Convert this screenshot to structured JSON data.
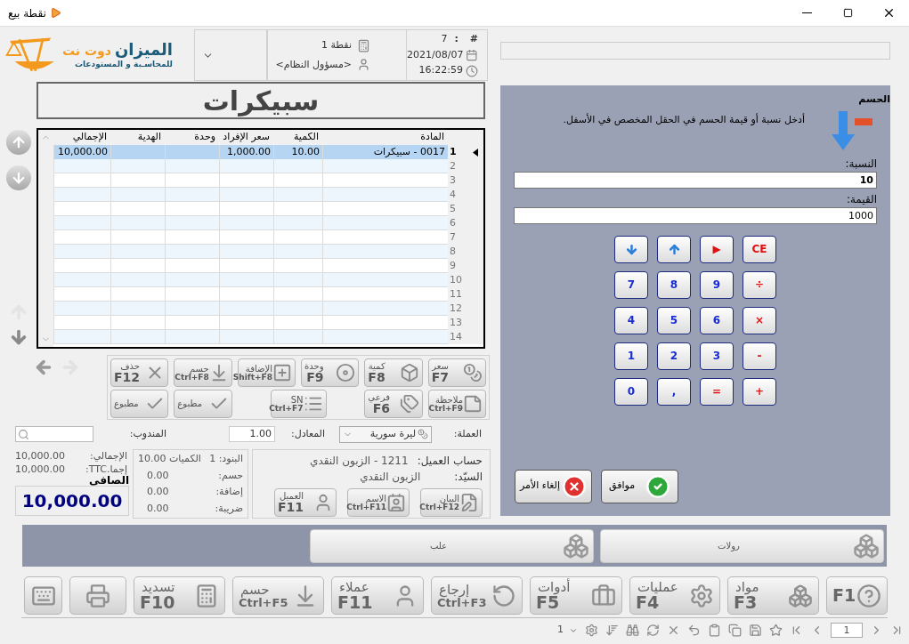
{
  "window": {
    "title": "نقطة بيع"
  },
  "logo": {
    "name": "الميزان",
    "suffix": "دوت نت",
    "tagline": "للمحاسـبة و المستودعات"
  },
  "info": {
    "number_label": "#",
    "number_sep": ":",
    "number": "7",
    "date": "2021/08/07",
    "time": "16:22:59",
    "point": "نقطة 1",
    "user": "<مسؤول النظام>"
  },
  "item_title": "سبيكرات",
  "table": {
    "columns": [
      "المادة",
      "الكمية",
      "سعر الإفراد",
      "وحدة",
      "الهدية",
      "الإجمالي"
    ],
    "rows": [
      {
        "number": "1",
        "selected": true,
        "item": "0017 - سبيكرات",
        "quantity": "10.00",
        "unit_price": "1,000.00",
        "total": "10,000.00"
      },
      {
        "number": "2",
        "selected": false
      },
      {
        "number": "3",
        "selected": false
      },
      {
        "number": "4",
        "selected": false
      },
      {
        "number": "5",
        "selected": false
      },
      {
        "number": "6",
        "selected": false
      },
      {
        "number": "7",
        "selected": false
      },
      {
        "number": "8",
        "selected": false
      },
      {
        "number": "9",
        "selected": false
      },
      {
        "number": "10",
        "selected": false
      },
      {
        "number": "11",
        "selected": false
      },
      {
        "number": "12",
        "selected": false
      },
      {
        "number": "13",
        "selected": false
      },
      {
        "number": "14",
        "selected": false
      }
    ]
  },
  "actions": [
    [
      {
        "label": "سعر",
        "key": "F7"
      },
      {
        "label": "كمية",
        "key": "F8"
      },
      {
        "label": "وحدة",
        "key": "F9"
      },
      {
        "label": "الإضافة",
        "key": "Shift+F8"
      },
      {
        "label": "حسم",
        "key": "Ctrl+F8"
      },
      {
        "label": "حذف",
        "key": "F12"
      }
    ],
    [
      {
        "label": "ملاحظة",
        "key": "Ctrl+F9"
      },
      {
        "label": "فرعي",
        "key": "F6"
      },
      {
        "label": "SN",
        "key": "Ctrl+F7"
      },
      {
        "label": "مطبوع"
      },
      {
        "label": "مطبوع"
      }
    ]
  ],
  "currency": {
    "label": "العملة:",
    "value": "ليرة سورية"
  },
  "rate": {
    "label": "المعادل:",
    "value": "1.00"
  },
  "rep": {
    "label": "المندوب:"
  },
  "customer": {
    "account_label": "حساب العميل:",
    "account": "1211 - الزبون النقدي",
    "name_label": "السيّد:",
    "name": "الزبون النقدي",
    "buttons": [
      {
        "label": "البيان",
        "key": "Ctrl+F12"
      },
      {
        "label": "الاسم",
        "key": "Ctrl+F11"
      },
      {
        "label": "العميل",
        "key": "F11"
      }
    ]
  },
  "summary": {
    "items_label": "البنود:",
    "items": "1",
    "quantities_label": "الكميات",
    "quantities": "10.00",
    "lines": [
      {
        "label": "حسم:",
        "value": "0.00"
      },
      {
        "label": "إضافة:",
        "value": "0.00"
      },
      {
        "label": "ضريبة:",
        "value": "0.00"
      }
    ]
  },
  "totals": {
    "lines": [
      {
        "label": "الإجمالي:",
        "value": "10,000.00"
      },
      {
        "label": "إجما.TTC:",
        "value": "10,000.00"
      }
    ],
    "net_label": "الصافى",
    "net": "10,000.00"
  },
  "discount": {
    "title": "الحسم",
    "hint": "أدخل نسبة أو قيمة الحسم في الحقل المخصص في الأسفل.",
    "percent_label": "النسبة:",
    "percent": "10",
    "amount_label": "القيمة:",
    "amount": "1000",
    "keypad": [
      [
        {
          "kind": "operator",
          "label": "CE"
        },
        {
          "kind": "operator",
          "label": "▶"
        },
        {
          "kind": "up"
        },
        {
          "kind": "down"
        }
      ],
      [
        {
          "kind": "operator",
          "label": "÷"
        },
        {
          "kind": "digit",
          "label": "9"
        },
        {
          "kind": "digit",
          "label": "8"
        },
        {
          "kind": "digit",
          "label": "7"
        }
      ],
      [
        {
          "kind": "operator",
          "label": "×"
        },
        {
          "kind": "digit",
          "label": "6"
        },
        {
          "kind": "digit",
          "label": "5"
        },
        {
          "kind": "digit",
          "label": "4"
        }
      ],
      [
        {
          "kind": "operator",
          "label": "-"
        },
        {
          "kind": "digit",
          "label": "3"
        },
        {
          "kind": "digit",
          "label": "2"
        },
        {
          "kind": "digit",
          "label": "1"
        }
      ],
      [
        {
          "kind": "operator",
          "label": "+"
        },
        {
          "kind": "operator",
          "label": "="
        },
        {
          "kind": "digit",
          "label": ","
        },
        {
          "kind": "digit",
          "label": "0"
        }
      ]
    ],
    "cancel": "إلغاء الأمر",
    "ok": "موافق"
  },
  "categories": [
    "رولات",
    "علب"
  ],
  "toolbar": [
    {
      "kind": "key",
      "key": "F1"
    },
    {
      "kind": "labeled",
      "label": "مواد",
      "key": "F3"
    },
    {
      "kind": "labeled",
      "label": "عمليات",
      "key": "F4"
    },
    {
      "kind": "labeled",
      "label": "أدوات",
      "key": "F5"
    },
    {
      "kind": "labeled",
      "label": "إرجاع",
      "key": "Ctrl+F3"
    },
    {
      "kind": "labeled",
      "label": "عملاء",
      "key": "F11"
    },
    {
      "kind": "labeled",
      "label": "حسم",
      "key": "Ctrl+F5"
    },
    {
      "kind": "labeled",
      "label": "تسديد",
      "key": "F10"
    },
    {
      "kind": "icon"
    },
    {
      "kind": "icon"
    }
  ],
  "status_bar": {
    "page": "1",
    "page_size": "1"
  }
}
